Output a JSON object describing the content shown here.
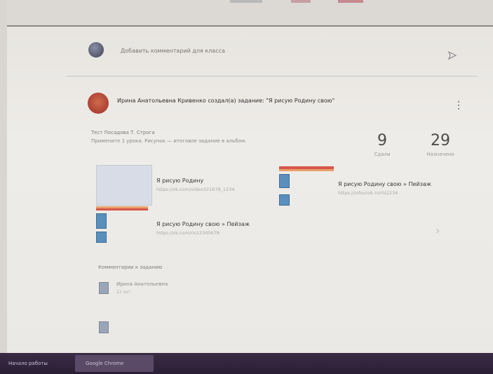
{
  "comment": {
    "placeholder": "Добавить комментарий для класса"
  },
  "post": {
    "title": "Ирина Анатольевна Кривенко создал(а) задание: \"Я рисую Родину свою\"",
    "description_line1": "Тест Посадова Т. Строга",
    "description_line2": "Примените 1 урока. Рисунок — итоговое задание в альбом."
  },
  "stats": [
    {
      "value": "9",
      "label": "Сдали"
    },
    {
      "value": "29",
      "label": "Назначено"
    }
  ],
  "attachments": [
    {
      "title": "Я рисую Родину",
      "url": "https://vk.com/video321678_1234"
    },
    {
      "title": "Я рисую Родину свою » Пейзаж",
      "url": "https://infourok.ru/ris1234"
    },
    {
      "title": "Я рисую Родину свою » Пейзаж",
      "url": "https://vk.com/ris12345678"
    }
  ],
  "section": {
    "label": "Комментарии к заданию"
  },
  "students": [
    {
      "name": "Ирина Анатольевна",
      "sub": "12 окт."
    },
    {
      "name": "",
      "sub": ""
    }
  ],
  "taskbar": {
    "start_label": "Начало работы",
    "active_label": "Google Chrome"
  },
  "colors": {
    "accent_orange": "#e8a06a",
    "accent_red": "#d8564a",
    "file_blue": "#5a8fbd",
    "taskbar": "#2f2338"
  }
}
